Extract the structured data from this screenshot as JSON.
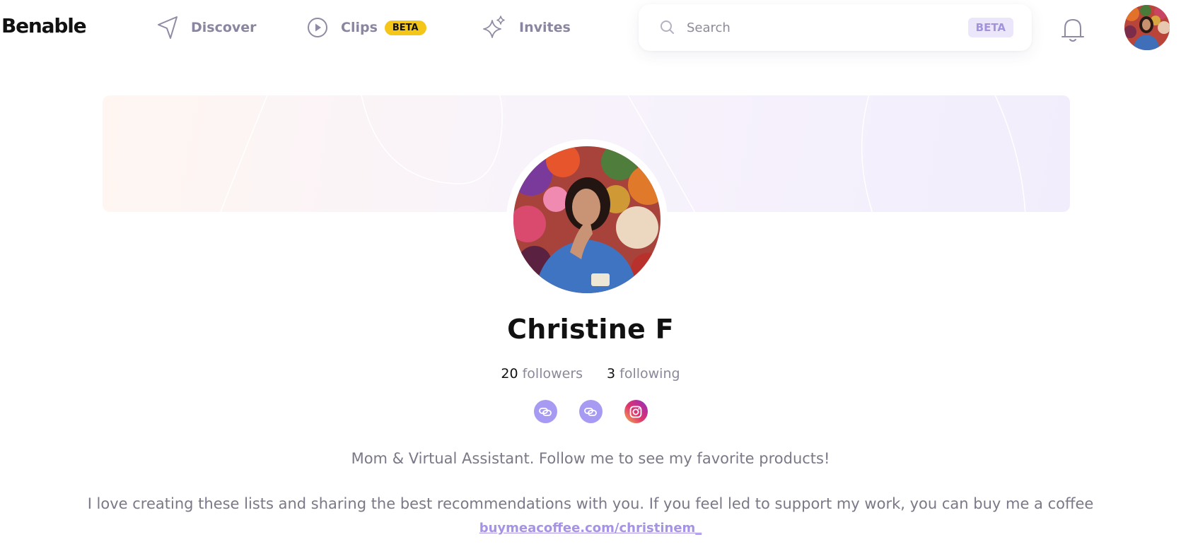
{
  "header": {
    "logo": "Benable",
    "nav": [
      {
        "label": "Discover",
        "icon": "navigation-arrow-icon"
      },
      {
        "label": "Clips",
        "icon": "play-circle-icon",
        "badge": "BETA"
      },
      {
        "label": "Invites",
        "icon": "sparkles-icon"
      }
    ],
    "search": {
      "placeholder": "Search",
      "badge": "BETA"
    },
    "notifications_icon": "bell-icon",
    "user_avatar": "user-avatar"
  },
  "profile": {
    "name": "Christine F",
    "followers": {
      "count": "20",
      "label": "followers"
    },
    "following": {
      "count": "3",
      "label": "following"
    },
    "socials": [
      "link-icon",
      "link-icon",
      "instagram-icon"
    ],
    "bio_line1": "Mom & Virtual Assistant. Follow me to see my favorite products!",
    "bio_line2": "I love creating these lists and sharing the best recommendations with you. If you feel led to support my work, you can buy me a coffee",
    "bio_link": "buymeacoffee.com/christinem_"
  },
  "colors": {
    "accent": "#a79af2",
    "beta_yellow": "#f5c61a",
    "link": "#a693e6",
    "nav_text": "#8a86a0"
  }
}
